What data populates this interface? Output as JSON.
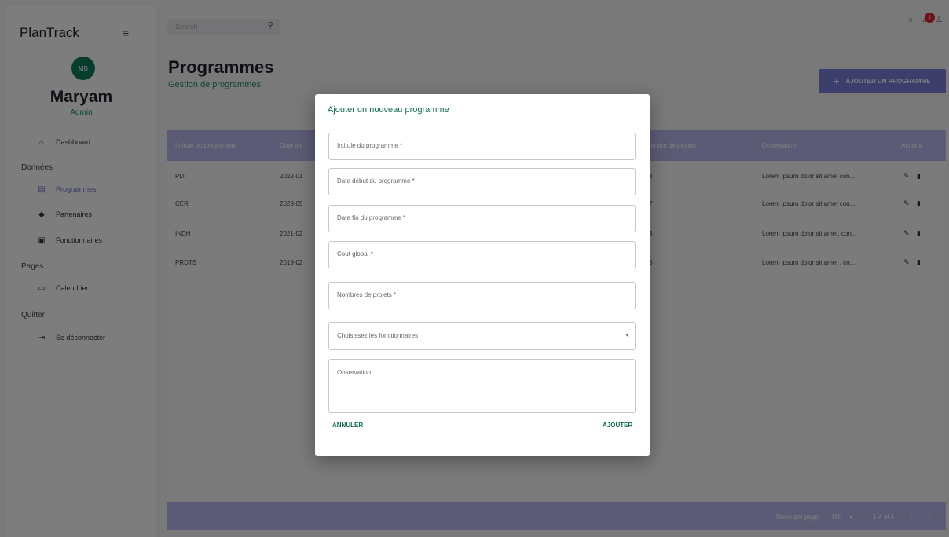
{
  "app": {
    "brand": "PlanTrack"
  },
  "user": {
    "initials": "MB",
    "name": "Maryam",
    "role": "Admin"
  },
  "sidebar": {
    "dashboard": "Dashboard",
    "section_data": "Données",
    "programmes": "Programmes",
    "partenaires": "Partenaires",
    "fonctionnaires": "Fonctionnaires",
    "section_pages": "Pages",
    "calendrier": "Calendrier",
    "section_quit": "Quitter",
    "logout": "Se déconnecter"
  },
  "topbar": {
    "search_placeholder": "Search",
    "notification_count": "1"
  },
  "page": {
    "title": "Programmes",
    "subtitle": "Gestion de programmes",
    "add_button": "AJOUTER UN PROGRAMME"
  },
  "table": {
    "headers": {
      "intitule": "Intitule du programme",
      "date": "Date de",
      "nombre": "ombre de projets",
      "observation": "Observation",
      "actions": "Actions"
    },
    "rows": [
      {
        "intitule": "PDI",
        "date": "2022-01",
        "nombre": "3",
        "observation": "Lorem ipsum dolor sit amet con..."
      },
      {
        "intitule": "CER",
        "date": "2023-05",
        "nombre": "7",
        "observation": "Lorem ipsum dolor sit amet con..."
      },
      {
        "intitule": "INDH",
        "date": "2021-02",
        "nombre": "3",
        "observation": "Lorem ipsum dolor sit amet, con..."
      },
      {
        "intitule": "PRDTS",
        "date": "2019-02",
        "nombre": "5",
        "observation": "Lorem ipsum dolor sit amet , co..."
      }
    ],
    "footer": {
      "rows_per_page_label": "Rows per page:",
      "rows_per_page_value": "100",
      "range": "1-4 of 4"
    }
  },
  "modal": {
    "title": "Ajouter un nouveau programme",
    "fields": {
      "intitule": "Intitule du programme *",
      "date_debut": "Date début du programme *",
      "date_fin": "Date fin du programme *",
      "cout": "Cout global *",
      "nombre": "Nombres de projets *",
      "fonctionnaires": "Choisissez les fonctionnaires",
      "observation": "Observation"
    },
    "cancel": "ANNULER",
    "submit": "AJOUTER"
  }
}
